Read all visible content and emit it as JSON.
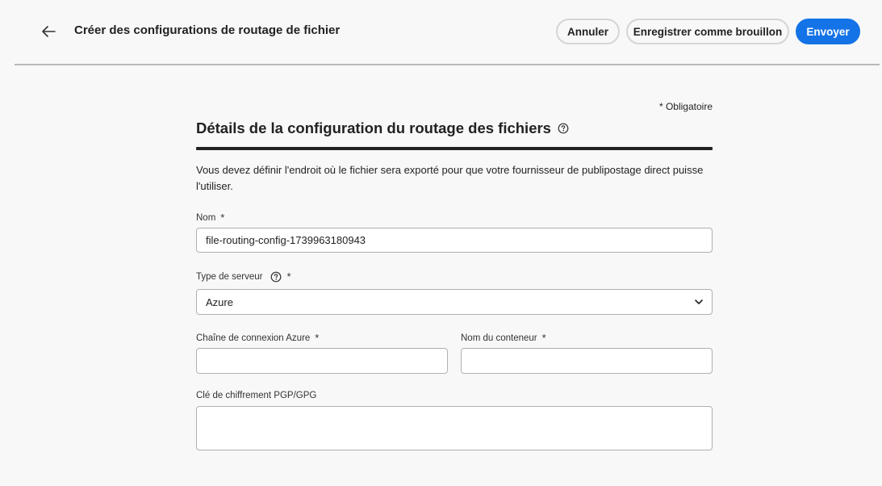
{
  "header": {
    "title": "Créer des configurations de routage de fichier",
    "buttons": {
      "cancel": "Annuler",
      "save_draft": "Enregistrer comme brouillon",
      "send": "Envoyer"
    },
    "icons": {
      "back": "arrow-left-icon"
    }
  },
  "form": {
    "required_note": "* Obligatoire",
    "section_title": "Détails de la configuration du routage des fichiers",
    "description": "Vous devez définir l'endroit où le fichier sera exporté pour que votre fournisseur de publipostage direct puisse l'utiliser.",
    "fields": {
      "name": {
        "label": "Nom",
        "required_mark": "*",
        "value": "file-routing-config-1739963180943"
      },
      "server_type": {
        "label": "Type de serveur",
        "required_mark": "*",
        "value": "Azure"
      },
      "azure_connection": {
        "label": "Chaîne de connexion Azure",
        "required_mark": "*",
        "value": ""
      },
      "container_name": {
        "label": "Nom du conteneur",
        "required_mark": "*",
        "value": ""
      },
      "pgp_key": {
        "label": "Clé de chiffrement PGP/GPG",
        "value": ""
      }
    }
  },
  "colors": {
    "primary": "#1473e6",
    "background": "#f8f8f8",
    "text": "#222222"
  }
}
